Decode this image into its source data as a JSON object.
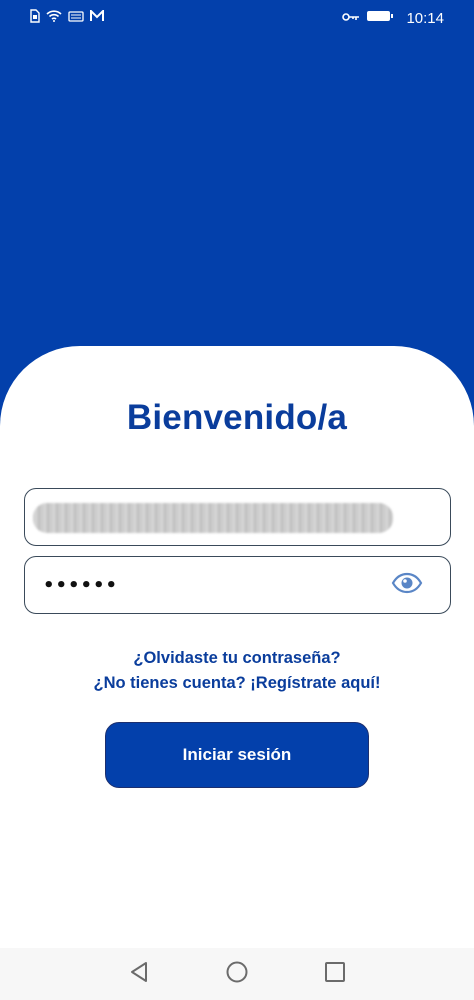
{
  "status_bar": {
    "time": "10:14",
    "left_icons": [
      "sim-icon",
      "wifi-icon",
      "keyboard-icon",
      "mail-icon"
    ],
    "right_icons": [
      "key-icon",
      "battery-icon"
    ]
  },
  "login": {
    "title": "Bienvenido/a",
    "email_value": "",
    "password_value": "••••••",
    "forgot_password": "¿Olvidaste tu contraseña?",
    "register": "¿No tienes cuenta? ¡Regístrate aquí!",
    "submit_label": "Iniciar sesión"
  },
  "colors": {
    "primary": "#0340ab",
    "title_text": "#0a3d9c",
    "field_border": "#3a4a5a",
    "eye_icon": "#5a86c6"
  },
  "nav_bar": {
    "icons": [
      "back-icon",
      "home-icon",
      "recents-icon"
    ]
  }
}
